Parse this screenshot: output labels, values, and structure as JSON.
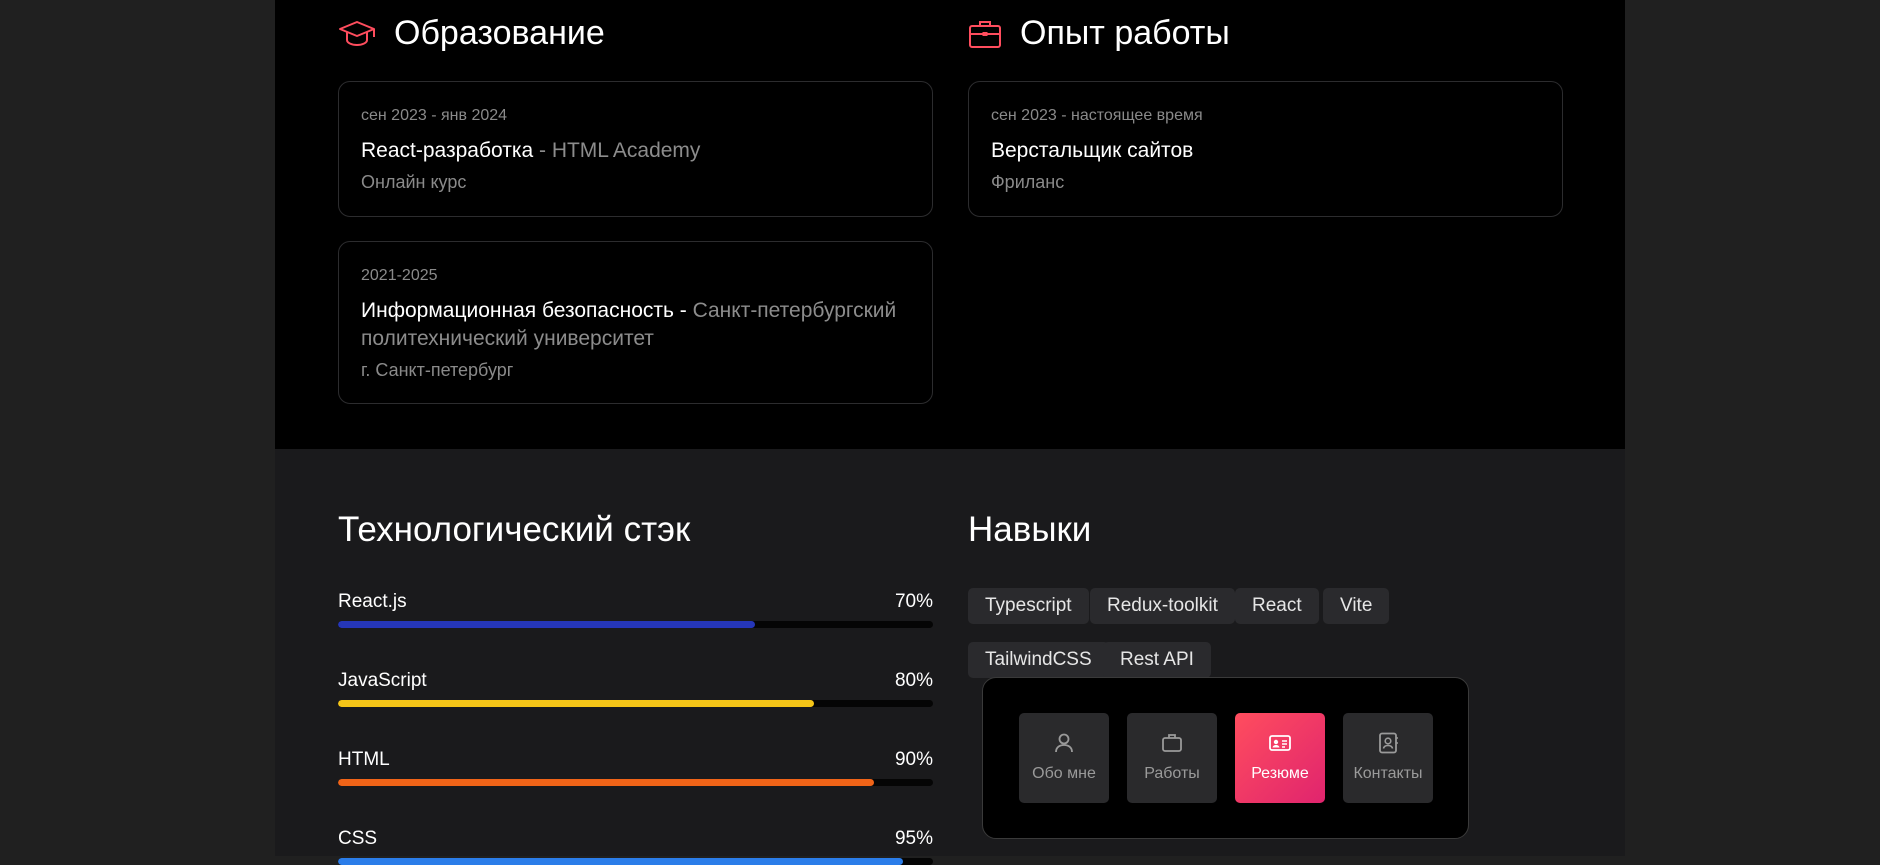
{
  "colors": {
    "accent": "#ff4d5e",
    "react": "#2536b8",
    "javascript": "#f5c518",
    "html": "#f06418",
    "css": "#2b7de9"
  },
  "education": {
    "title": "Образование",
    "icon": "graduation-cap-icon",
    "items": [
      {
        "date": "сен 2023 - янв 2024",
        "title": "React-разработка",
        "org": " - HTML Academy",
        "sub": "Онлайн курс"
      },
      {
        "date": "2021-2025",
        "title": "Информационная безопасность - ",
        "org": "Санкт-петербургский политехнический университет",
        "sub": "г. Санкт-петербург"
      }
    ]
  },
  "experience": {
    "title": "Опыт работы",
    "icon": "briefcase-icon",
    "items": [
      {
        "date": "сен 2023 - настоящее время",
        "title": "Верстальщик сайтов",
        "sub": "Фриланс"
      }
    ]
  },
  "stack": {
    "title": "Технологический стэк",
    "items": [
      {
        "name": "React.js",
        "percent_label": "70%",
        "value": 70
      },
      {
        "name": "JavaScript",
        "percent_label": "80%",
        "value": 80
      },
      {
        "name": "HTML",
        "percent_label": "90%",
        "value": 90
      },
      {
        "name": "CSS",
        "percent_label": "95%",
        "value": 95
      }
    ]
  },
  "skills": {
    "title": "Навыки",
    "tags": [
      "Typescript",
      "Redux-toolkit",
      "React",
      "Vite",
      "TailwindCSS",
      "Rest API"
    ]
  },
  "dock": {
    "items": [
      {
        "label": "Обо мне",
        "icon": "user-icon",
        "active": false
      },
      {
        "label": "Работы",
        "icon": "briefcase-icon",
        "active": false
      },
      {
        "label": "Резюме",
        "icon": "id-card-icon",
        "active": true
      },
      {
        "label": "Контакты",
        "icon": "contact-book-icon",
        "active": false
      }
    ]
  }
}
